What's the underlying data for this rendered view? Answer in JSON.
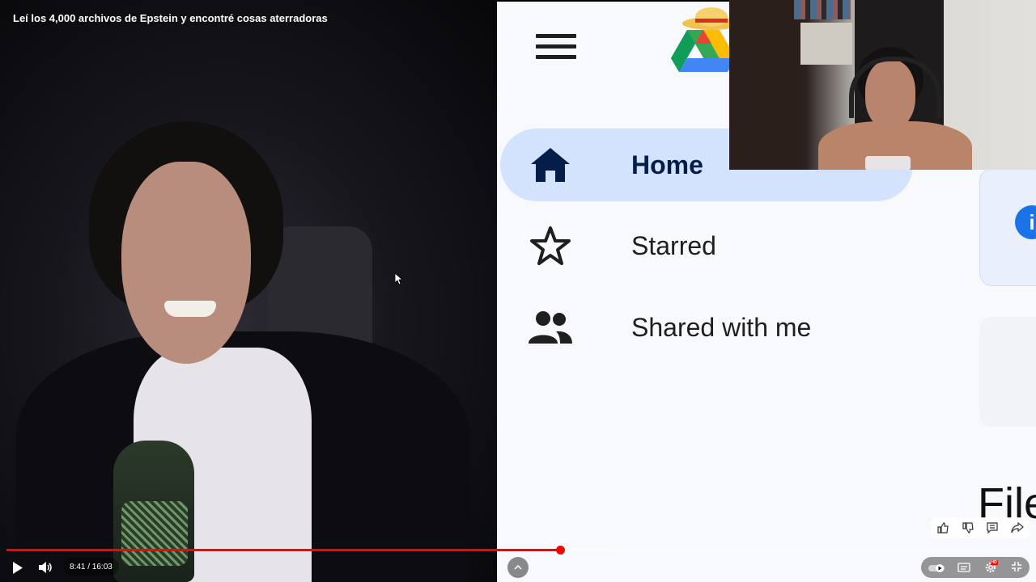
{
  "video": {
    "title": "Leí los 4,000 archivos de Epstein y encontré cosas aterradoras"
  },
  "drive": {
    "nav": [
      {
        "label": "Home",
        "icon": "home-icon",
        "active": true
      },
      {
        "label": "Starred",
        "icon": "star-icon",
        "active": false
      },
      {
        "label": "Shared with me",
        "icon": "people-icon",
        "active": false
      }
    ],
    "files_heading": "File",
    "info_glyph": "i"
  },
  "player": {
    "time_current": "8:41",
    "time_total": "16:03",
    "time_display": "8:41 / 16:03",
    "progress_fraction": 0.541,
    "hd_badge": "HD"
  },
  "colors": {
    "progress_played": "#ff0000",
    "drive_active_bg": "#d3e3fd",
    "drive_bg": "#f8f9fc"
  }
}
